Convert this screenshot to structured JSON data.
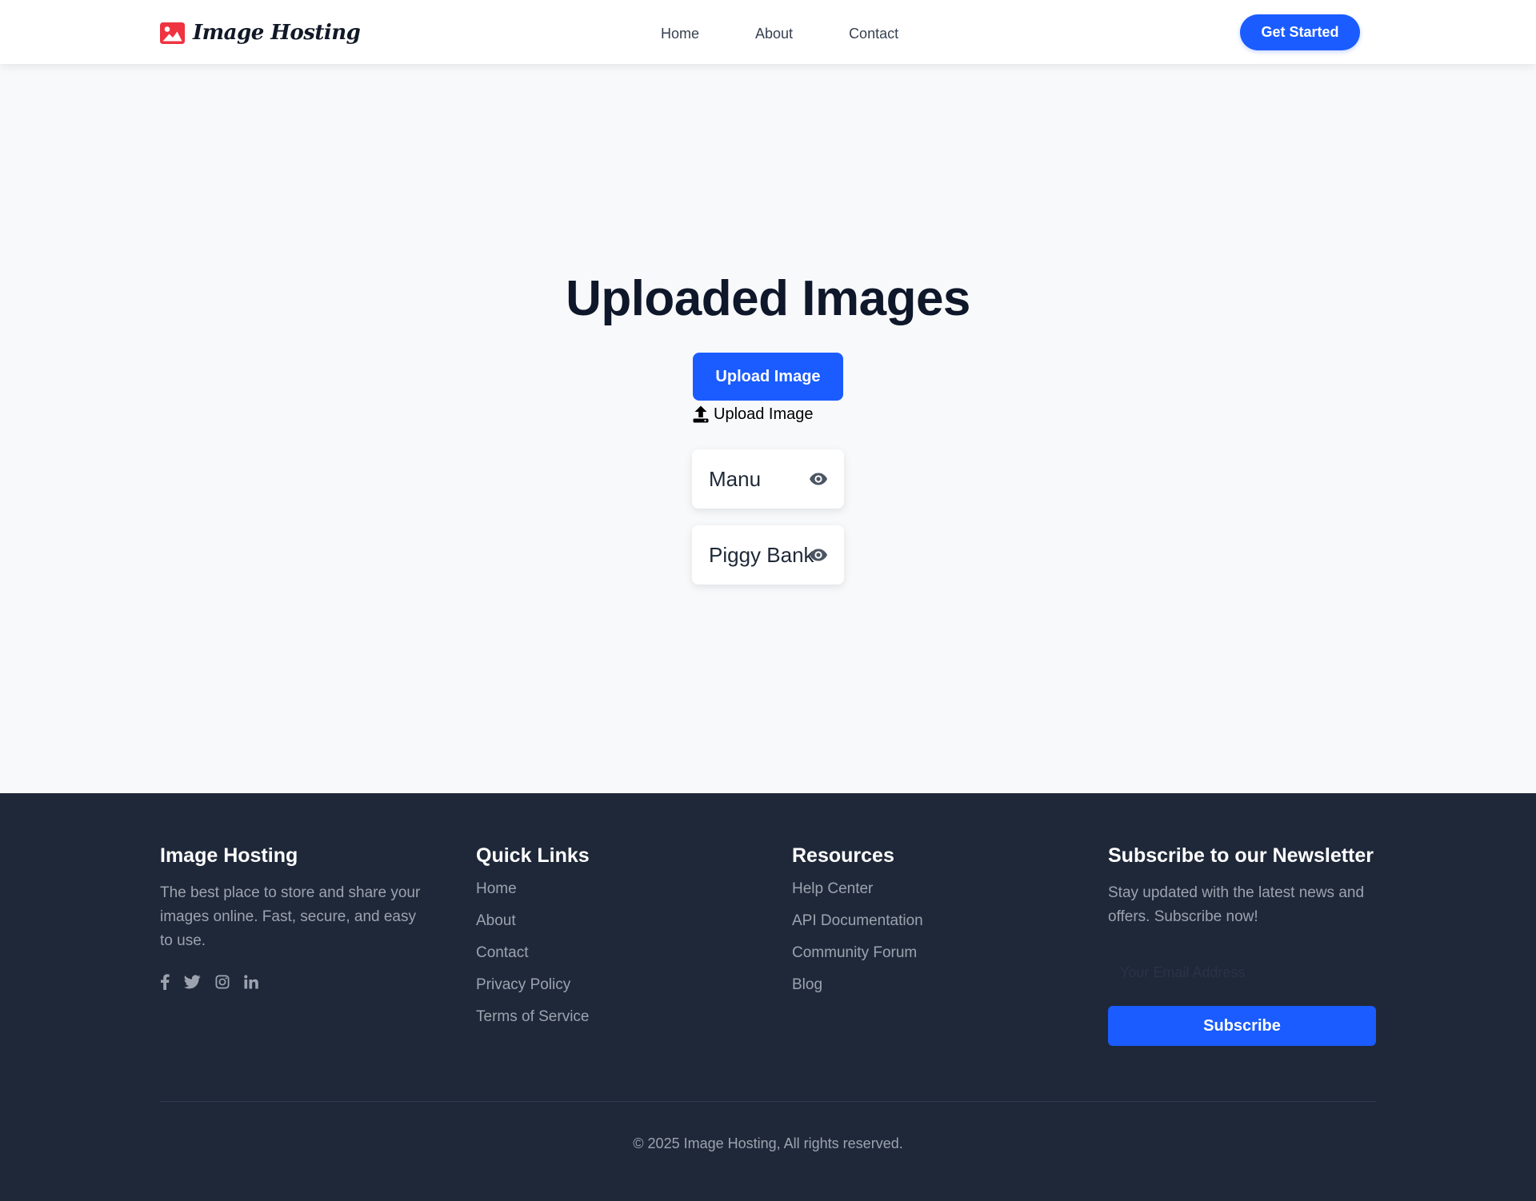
{
  "header": {
    "brand": "Image Hosting",
    "brand_icon": "image-icon",
    "nav": [
      "Home",
      "About",
      "Contact"
    ],
    "cta": "Get Started"
  },
  "main": {
    "title": "Uploaded Images",
    "upload_button": "Upload Image",
    "upload_link": "Upload Image",
    "upload_icon": "upload-icon",
    "images": [
      {
        "name": "Manu",
        "icon": "eye-icon"
      },
      {
        "name": "Piggy Bank",
        "icon": "eye-icon"
      }
    ]
  },
  "footer": {
    "about": {
      "title": "Image Hosting",
      "text": "The best place to store and share your images online. Fast, secure, and easy to use.",
      "socials": [
        "facebook-icon",
        "twitter-icon",
        "instagram-icon",
        "linkedin-icon"
      ]
    },
    "quick_links": {
      "title": "Quick Links",
      "items": [
        "Home",
        "About",
        "Contact",
        "Privacy Policy",
        "Terms of Service"
      ]
    },
    "resources": {
      "title": "Resources",
      "items": [
        "Help Center",
        "API Documentation",
        "Community Forum",
        "Blog"
      ]
    },
    "newsletter": {
      "title": "Subscribe to our Newsletter",
      "text": "Stay updated with the latest news and offers. Subscribe now!",
      "placeholder": "Your Email Address",
      "button": "Subscribe"
    },
    "copyright": "© 2025 Image Hosting, All rights reserved."
  },
  "colors": {
    "accent": "#1a5cff",
    "brand_icon": "#ef3340",
    "footer_bg": "#1f2839",
    "page_bg": "#f8f9fb"
  }
}
